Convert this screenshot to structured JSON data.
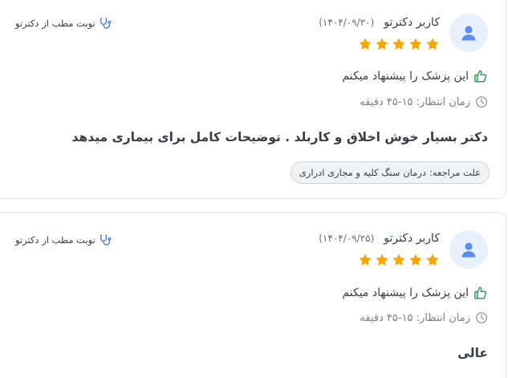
{
  "reviews": [
    {
      "user_name": "کاربر دکترتو",
      "date": "(۱۴۰۴/۰۹/۳۰)",
      "rating": 5,
      "recommend_text": "این پزشک را پیشنهاد میکنم",
      "wait_text": "زمان انتظار: ۱۵-۴۵ دقیقه",
      "comment": "دکتر بسیار خوش اخلاق و کاربلد . توضیحات کامل برای بیماری میدهد",
      "reason_label": "علت مراجعه:",
      "reason_value": "درمان سنگ کلیه و مجاری ادراری",
      "source_text": "نوبت مطب از دکترتو"
    },
    {
      "user_name": "کاربر دکترتو",
      "date": "(۱۴۰۴/۰۹/۲۵)",
      "rating": 5,
      "recommend_text": "این پزشک را پیشنهاد میکنم",
      "wait_text": "زمان انتظار: ۱۵-۴۵ دقیقه",
      "comment": "عالی",
      "source_text": "نوبت مطب از دکترتو"
    }
  ],
  "icons": {
    "avatar": "user-icon",
    "star": "star-icon",
    "recommend": "thumbs-up-icon",
    "wait": "clock-icon",
    "source": "stethoscope-icon"
  },
  "colors": {
    "star": "#f7a600",
    "thumbs_up": "#2f9e57",
    "avatar_bg": "#e8f0fd",
    "avatar_icon": "#5b8def",
    "stethoscope": "#3a6fd8",
    "clock": "#8a8d94"
  }
}
